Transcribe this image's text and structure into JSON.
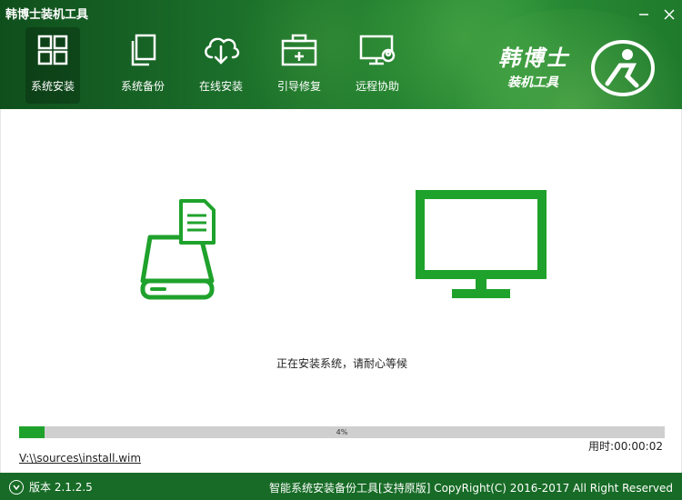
{
  "app": {
    "title": "韩博士装机工具"
  },
  "nav": {
    "items": [
      {
        "label": "系统安装",
        "icon": "windows-icon",
        "active": true
      },
      {
        "label": "系统备份",
        "icon": "copy-icon",
        "active": false
      },
      {
        "label": "在线安装",
        "icon": "cloud-download-icon",
        "active": false
      },
      {
        "label": "引导修复",
        "icon": "toolbox-icon",
        "active": false
      },
      {
        "label": "远程协助",
        "icon": "remote-monitor-icon",
        "active": false
      }
    ]
  },
  "logo": {
    "main": "韩博士",
    "sub": "装机工具"
  },
  "install": {
    "status": "正在安装系统，请耐心等候",
    "progress_text": "4%",
    "progress": 0.04,
    "elapsed": "用时:00:00:02",
    "file_path": "V:\\\\sources\\install.wim"
  },
  "footer": {
    "version": "版本 2.1.2.5",
    "copyright": "智能系统安装备份工具[支持原版]  CopyRight(C) 2016-2017 All Right Reserved"
  },
  "colors": {
    "accent": "#1fa22c",
    "header": "#1a6b29",
    "footer": "#176b26"
  }
}
